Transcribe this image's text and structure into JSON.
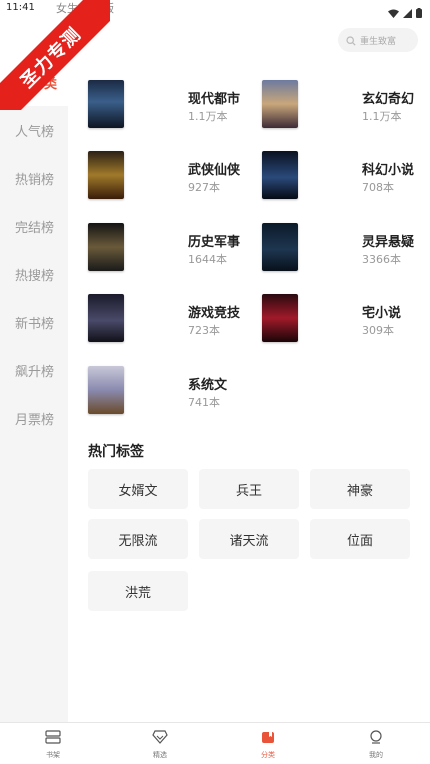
{
  "status_bar": {
    "time": "11:41"
  },
  "watermark": {
    "text": "圣力专测"
  },
  "top_tabs": {
    "female": "女生",
    "publish": "出版"
  },
  "search": {
    "placeholder": "重生致富"
  },
  "sidebar": {
    "active": "部分类",
    "items": [
      "人气榜",
      "热销榜",
      "完结榜",
      "热搜榜",
      "新书榜",
      "飙升榜",
      "月票榜"
    ]
  },
  "categories": [
    {
      "name": "现代都市",
      "count": "1.1万本"
    },
    {
      "name": "玄幻奇幻",
      "count": "1.1万本"
    },
    {
      "name": "武侠仙侠",
      "count": "927本"
    },
    {
      "name": "科幻小说",
      "count": "708本"
    },
    {
      "name": "历史军事",
      "count": "1644本"
    },
    {
      "name": "灵异悬疑",
      "count": "3366本"
    },
    {
      "name": "游戏竞技",
      "count": "723本"
    },
    {
      "name": "宅小说",
      "count": "309本"
    },
    {
      "name": "系统文",
      "count": "741本"
    }
  ],
  "hot_tags": {
    "title": "热门标签",
    "tags": [
      "女婿文",
      "兵王",
      "神豪",
      "无限流",
      "诸天流",
      "位面",
      "洪荒"
    ]
  },
  "bottom_nav": {
    "items": [
      "书架",
      "精选",
      "分类",
      "我的"
    ],
    "active_index": 2
  },
  "colors": {
    "accent": "#e8533a",
    "ribbon": "#e5211b"
  }
}
